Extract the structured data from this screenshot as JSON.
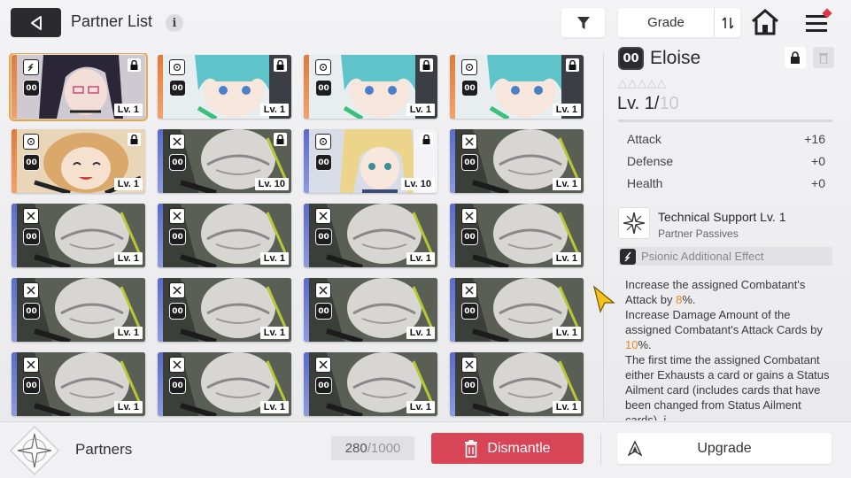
{
  "header": {
    "title": "Partner List",
    "info": "i",
    "sort_label": "Grade"
  },
  "colors": {
    "rarity_orange": "#e07b3a",
    "rarity_blue": "#5a6bc9",
    "selected_outline": "#e6a84a",
    "dismantle": "#d84556",
    "highlight": "#e8892b"
  },
  "partners": [
    {
      "level": "Lv. 1",
      "rarity": "orange",
      "art": "purple",
      "type": "sword",
      "locked": true,
      "selected": true
    },
    {
      "level": "Lv. 1",
      "rarity": "orange",
      "art": "cyan",
      "type": "circle",
      "locked": true
    },
    {
      "level": "Lv. 1",
      "rarity": "orange",
      "art": "cyan",
      "type": "circle",
      "locked": true
    },
    {
      "level": "Lv. 1",
      "rarity": "orange",
      "art": "cyan",
      "type": "circle",
      "locked": true
    },
    {
      "level": "Lv. 1",
      "rarity": "orange",
      "art": "blonde",
      "type": "circle",
      "locked": true
    },
    {
      "level": "Lv. 10",
      "rarity": "blue",
      "art": "mech",
      "type": "cross",
      "locked": true
    },
    {
      "level": "Lv. 10",
      "rarity": "blue",
      "art": "blonde2",
      "type": "circle",
      "locked": true
    },
    {
      "level": "Lv. 1",
      "rarity": "blue",
      "art": "mech",
      "type": "cross",
      "locked": false
    },
    {
      "level": "Lv. 1",
      "rarity": "blue",
      "art": "mech",
      "type": "cross",
      "locked": false
    },
    {
      "level": "Lv. 1",
      "rarity": "blue",
      "art": "mech",
      "type": "cross",
      "locked": false
    },
    {
      "level": "Lv. 1",
      "rarity": "blue",
      "art": "mech",
      "type": "cross",
      "locked": false
    },
    {
      "level": "Lv. 1",
      "rarity": "blue",
      "art": "mech",
      "type": "cross",
      "locked": false
    },
    {
      "level": "Lv. 1",
      "rarity": "blue",
      "art": "mech",
      "type": "cross",
      "locked": false
    },
    {
      "level": "Lv. 1",
      "rarity": "blue",
      "art": "mech",
      "type": "cross",
      "locked": false
    },
    {
      "level": "Lv. 1",
      "rarity": "blue",
      "art": "mech",
      "type": "cross",
      "locked": false
    },
    {
      "level": "Lv. 1",
      "rarity": "blue",
      "art": "mech",
      "type": "cross",
      "locked": false
    },
    {
      "level": "Lv. 1",
      "rarity": "blue",
      "art": "mech",
      "type": "cross",
      "locked": false
    },
    {
      "level": "Lv. 1",
      "rarity": "blue",
      "art": "mech",
      "type": "cross",
      "locked": false
    },
    {
      "level": "Lv. 1",
      "rarity": "blue",
      "art": "mech",
      "type": "cross",
      "locked": false
    },
    {
      "level": "Lv. 1",
      "rarity": "blue",
      "art": "mech",
      "type": "cross",
      "locked": false
    }
  ],
  "rank_badge": "00",
  "detail": {
    "rank": "00",
    "name": "Eloise",
    "stars": "△△△△△",
    "level_current": "Lv. 1/",
    "level_max": "10",
    "stats": [
      {
        "label": "Attack",
        "value": "+16"
      },
      {
        "label": "Defense",
        "value": "+0"
      },
      {
        "label": "Health",
        "value": "+0"
      }
    ],
    "passive_name": "Technical Support Lv. 1",
    "passive_sub": "Partner Passives",
    "psionic_label": "Psionic Additional Effect",
    "effect": {
      "p1a": "Increase the assigned Combatant's Attack by ",
      "p1v": "8",
      "p1b": "%.",
      "p2a": "Increase Damage Amount of the assigned Combatant's Attack Cards by ",
      "p2v": "10",
      "p2b": "%.",
      "p3": "The first time the assigned Combatant either Exhausts a card or gains a Status Ailment card (includes cards that have been changed from Status Ailment cards), i"
    }
  },
  "footer": {
    "section_label": "Partners",
    "count_current": "280",
    "count_sep": " / ",
    "count_total": "1000",
    "dismantle_label": "Dismantle",
    "upgrade_label": "Upgrade"
  }
}
